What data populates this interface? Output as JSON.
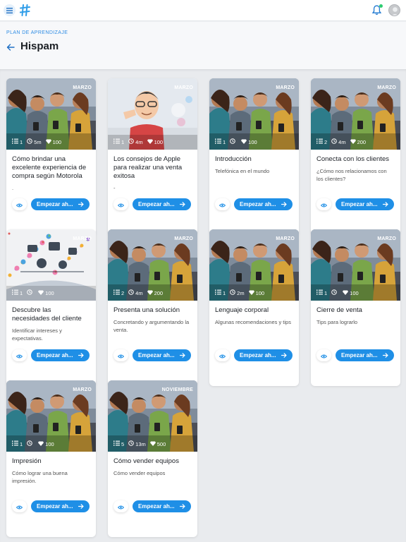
{
  "header": {
    "eyebrow": "PLAN DE APRENDIZAJE",
    "title": "Hispam"
  },
  "colors": {
    "accent": "#1f8fe6",
    "eyebrow": "#2f8de4",
    "notification_dot": "#2ecc71"
  },
  "icons": {
    "menu": "menu-icon",
    "logo": "hashtag-logo",
    "bell": "bell-icon",
    "back": "arrow-left-icon",
    "lessons": "list-icon",
    "time": "clock-icon",
    "points": "gem-icon",
    "view": "eye-icon",
    "start": "arrow-right-icon"
  },
  "cards": [
    {
      "badge": "MARZO",
      "lessons": "1",
      "time": "5m",
      "points": "100",
      "title": "Cómo brindar una excelente experiencia de compra según Motorola",
      "desc": ".",
      "start_label": "Empezar ah...",
      "image": "people-phones"
    },
    {
      "badge": "MARZO",
      "lessons": "1",
      "time": "4m",
      "points": "100",
      "title": "Los consejos de Apple para realizar una venta exitosa",
      "desc": "-",
      "start_label": "Empezar ah...",
      "image": "cartoon-man"
    },
    {
      "badge": "MARZO",
      "lessons": "1",
      "time": "",
      "points": "100",
      "title": "Introducción",
      "desc": "Telefónica en el mundo",
      "start_label": "Empezar ah...",
      "image": "people-phones"
    },
    {
      "badge": "MARZO",
      "lessons": "2",
      "time": "4m",
      "points": "200",
      "title": "Conecta con los clientes",
      "desc": "¿Cómo nos relacionamos con los clientes?",
      "start_label": "Empezar ah...",
      "image": "people-phones"
    },
    {
      "badge": "MARZO",
      "lessons": "1",
      "time": "",
      "points": "100",
      "title": "Descubre las necesidades del cliente",
      "desc": "Identificar intereses y expectativas.",
      "start_label": "Empezar ah...",
      "image": "icons-network"
    },
    {
      "badge": "MARZO",
      "lessons": "2",
      "time": "4m",
      "points": "200",
      "title": "Presenta una solución",
      "desc": "Concretando y argumentando la venta.",
      "start_label": "Empezar ah...",
      "image": "people-phones"
    },
    {
      "badge": "MARZO",
      "lessons": "1",
      "time": "2m",
      "points": "100",
      "title": "Lenguaje corporal",
      "desc": "Algunas recomendaciones y tips",
      "start_label": "Empezar ah...",
      "image": "people-phones"
    },
    {
      "badge": "MARZO",
      "lessons": "1",
      "time": "",
      "points": "100",
      "title": "Cierre de venta",
      "desc": "Tips para lograrlo",
      "start_label": "Empezar ah...",
      "image": "people-phones"
    },
    {
      "badge": "MARZO",
      "lessons": "1",
      "time": "",
      "points": "100",
      "title": "Impresión",
      "desc": "Cómo lograr una buena impresión.",
      "start_label": "Empezar ah...",
      "image": "people-phones"
    },
    {
      "badge": "NOVIEMBRE",
      "lessons": "5",
      "time": "13m",
      "points": "500",
      "title": "Cómo vender equipos",
      "desc": "Cómo vender equipos",
      "start_label": "Empezar ah...",
      "image": "people-phones"
    }
  ]
}
